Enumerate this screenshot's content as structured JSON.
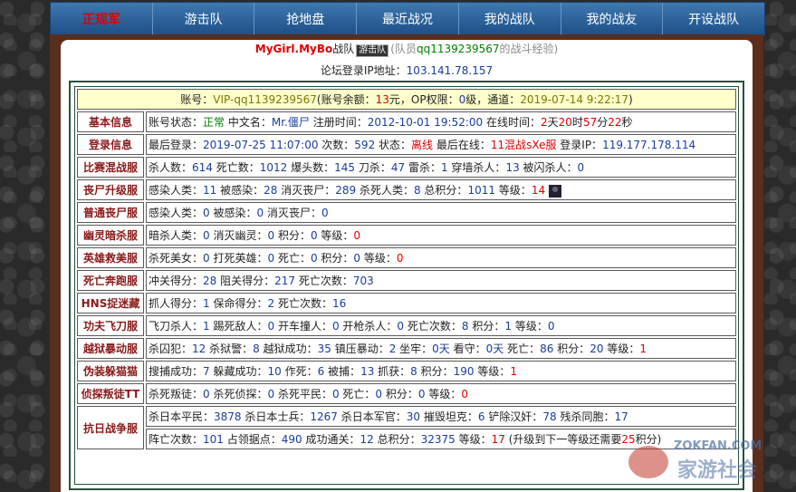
{
  "nav": [
    "正规军",
    "游击队",
    "抢地盘",
    "最近战况",
    "我的战队",
    "我的战友",
    "开设战队"
  ],
  "title": {
    "team": "MyGirl.MyBo",
    "team_suffix": "战队",
    "badge": "游击队",
    "member_prefix": "(队员",
    "member": "qq1139239567",
    "member_suffix": "的战斗经验)"
  },
  "ip": {
    "label": "论坛登录IP地址：",
    "value": "103.141.78.157"
  },
  "account": {
    "l1": "账号：",
    "id": "VIP-qq1139239567",
    "l2": "(账号余额：",
    "balance": "13",
    "l3": "元，OP权限：",
    "op": "0",
    "l4": "级，通道：",
    "date": "2019-07-14 9:22:17",
    "l5": ")"
  },
  "rows": [
    {
      "label": "基本信息",
      "parts": [
        [
          "账号状态：",
          ""
        ],
        [
          "正常",
          "g"
        ],
        [
          " 中文名：",
          ""
        ],
        [
          "Mr.僵尸",
          "b"
        ],
        [
          " 注册时间：",
          ""
        ],
        [
          "2012-10-01 19:52:00",
          "b"
        ],
        [
          " 在线时间：",
          ""
        ],
        [
          "2",
          "r"
        ],
        [
          "天",
          ""
        ],
        [
          "20",
          "r"
        ],
        [
          "时",
          ""
        ],
        [
          "57",
          "r"
        ],
        [
          "分",
          ""
        ],
        [
          "22",
          "r"
        ],
        [
          "秒",
          ""
        ]
      ]
    },
    {
      "label": "登录信息",
      "parts": [
        [
          "最后登录：",
          ""
        ],
        [
          "2019-07-25 11:07:00",
          "b"
        ],
        [
          " 次数：",
          ""
        ],
        [
          "592",
          "b"
        ],
        [
          " 状态：",
          ""
        ],
        [
          "离线",
          "r"
        ],
        [
          " 最后在线：",
          ""
        ],
        [
          "11混战sXe服",
          "r"
        ],
        [
          " 登录IP：",
          ""
        ],
        [
          "119.177.178.114",
          "b"
        ]
      ]
    },
    {
      "label": "比赛混战服",
      "parts": [
        [
          "杀人数：",
          ""
        ],
        [
          "614",
          "b"
        ],
        [
          " 死亡数：",
          ""
        ],
        [
          "1012",
          "b"
        ],
        [
          " 爆头数：",
          ""
        ],
        [
          "145",
          "b"
        ],
        [
          " 刀杀：",
          ""
        ],
        [
          "47",
          "b"
        ],
        [
          " 雷杀：",
          ""
        ],
        [
          "1",
          "b"
        ],
        [
          " 穿墙杀人：",
          ""
        ],
        [
          "13",
          "b"
        ],
        [
          " 被闪杀人：",
          ""
        ],
        [
          "0",
          "b"
        ]
      ]
    },
    {
      "label": "丧尸升级服",
      "avatar": true,
      "parts": [
        [
          "感染人类：",
          ""
        ],
        [
          "11",
          "b"
        ],
        [
          " 被感染：",
          ""
        ],
        [
          "28",
          "b"
        ],
        [
          " 消灭丧尸：",
          ""
        ],
        [
          "289",
          "b"
        ],
        [
          " 杀死人类：",
          ""
        ],
        [
          "8",
          "b"
        ],
        [
          " 总积分：",
          ""
        ],
        [
          "1011",
          "b"
        ],
        [
          " 等级：",
          ""
        ],
        [
          "14",
          "r"
        ]
      ]
    },
    {
      "label": "普通丧尸服",
      "parts": [
        [
          "感染人类：",
          ""
        ],
        [
          "0",
          "b"
        ],
        [
          " 被感染：",
          ""
        ],
        [
          "0",
          "b"
        ],
        [
          " 消灭丧尸：",
          ""
        ],
        [
          "0",
          "b"
        ]
      ]
    },
    {
      "label": "幽灵暗杀服",
      "parts": [
        [
          "暗杀人类：",
          ""
        ],
        [
          "0",
          "b"
        ],
        [
          " 消灭幽灵：",
          ""
        ],
        [
          "0",
          "b"
        ],
        [
          " 积分：",
          ""
        ],
        [
          "0",
          "b"
        ],
        [
          " 等级：",
          ""
        ],
        [
          "0",
          "r"
        ]
      ]
    },
    {
      "label": "英雄救美服",
      "parts": [
        [
          "杀死美女：",
          ""
        ],
        [
          "0",
          "b"
        ],
        [
          " 打死英雄：",
          ""
        ],
        [
          "0",
          "b"
        ],
        [
          " 死亡：",
          ""
        ],
        [
          "0",
          "b"
        ],
        [
          " 积分：",
          ""
        ],
        [
          "0",
          "b"
        ],
        [
          " 等级：",
          ""
        ],
        [
          "0",
          "r"
        ]
      ]
    },
    {
      "label": "死亡奔跑服",
      "parts": [
        [
          "冲关得分：",
          ""
        ],
        [
          "28",
          "b"
        ],
        [
          " 阻关得分：",
          ""
        ],
        [
          "217",
          "b"
        ],
        [
          " 死亡次数：",
          ""
        ],
        [
          "703",
          "b"
        ]
      ]
    },
    {
      "label": "HNS捉迷藏",
      "parts": [
        [
          "抓人得分：",
          ""
        ],
        [
          "1",
          "b"
        ],
        [
          " 保命得分：",
          ""
        ],
        [
          "2",
          "b"
        ],
        [
          " 死亡次数：",
          ""
        ],
        [
          "16",
          "b"
        ]
      ]
    },
    {
      "label": "功夫飞刀服",
      "parts": [
        [
          "飞刀杀人：",
          ""
        ],
        [
          "1",
          "b"
        ],
        [
          " 踢死敌人：",
          ""
        ],
        [
          "0",
          "b"
        ],
        [
          " 开车撞人：",
          ""
        ],
        [
          "0",
          "b"
        ],
        [
          " 开枪杀人：",
          ""
        ],
        [
          "0",
          "b"
        ],
        [
          " 死亡次数：",
          ""
        ],
        [
          "8",
          "b"
        ],
        [
          " 积分：",
          ""
        ],
        [
          "1",
          "b"
        ],
        [
          " 等级：",
          ""
        ],
        [
          "0",
          "b"
        ]
      ]
    },
    {
      "label": "越狱暴动服",
      "parts": [
        [
          "杀囚犯：",
          ""
        ],
        [
          "12",
          "b"
        ],
        [
          " 杀狱警：",
          ""
        ],
        [
          "8",
          "b"
        ],
        [
          " 越狱成功：",
          ""
        ],
        [
          "35",
          "b"
        ],
        [
          " 镇压暴动：",
          ""
        ],
        [
          "2",
          "b"
        ],
        [
          " 坐牢：",
          ""
        ],
        [
          "0天",
          "b"
        ],
        [
          " 看守：",
          ""
        ],
        [
          "0天",
          "b"
        ],
        [
          " 死亡：",
          ""
        ],
        [
          "86",
          "b"
        ],
        [
          " 积分：",
          ""
        ],
        [
          "20",
          "b"
        ],
        [
          " 等级：",
          ""
        ],
        [
          "1",
          "r"
        ]
      ]
    },
    {
      "label": "伪装躲猫猫",
      "parts": [
        [
          "搜捕成功：",
          ""
        ],
        [
          "7",
          "b"
        ],
        [
          " 躲藏成功：",
          ""
        ],
        [
          "10",
          "b"
        ],
        [
          " 作死：",
          ""
        ],
        [
          "6",
          "b"
        ],
        [
          " 被捕：",
          ""
        ],
        [
          "13",
          "b"
        ],
        [
          " 抓获：",
          ""
        ],
        [
          "8",
          "b"
        ],
        [
          " 积分：",
          ""
        ],
        [
          "190",
          "b"
        ],
        [
          " 等级：",
          ""
        ],
        [
          "1",
          "r"
        ]
      ]
    },
    {
      "label": "侦探叛徒TT",
      "parts": [
        [
          "杀死叛徒：",
          ""
        ],
        [
          "0",
          "b"
        ],
        [
          " 杀死侦探：",
          ""
        ],
        [
          "0",
          "b"
        ],
        [
          " 杀死平民：",
          ""
        ],
        [
          "0",
          "b"
        ],
        [
          " 死亡：",
          ""
        ],
        [
          "0",
          "b"
        ],
        [
          " 积分：",
          ""
        ],
        [
          "0",
          "b"
        ],
        [
          " 等级：",
          ""
        ],
        [
          "0",
          "r"
        ]
      ]
    }
  ],
  "war": {
    "label": "抗日战争服",
    "line1": [
      [
        "杀日本平民：",
        ""
      ],
      [
        "3878",
        "b"
      ],
      [
        " 杀日本士兵：",
        ""
      ],
      [
        "1267",
        "b"
      ],
      [
        " 杀日本军官：",
        ""
      ],
      [
        "30",
        "b"
      ],
      [
        " 摧毁坦克：",
        ""
      ],
      [
        "6",
        "b"
      ],
      [
        " 铲除汉奸：",
        ""
      ],
      [
        "78",
        "b"
      ],
      [
        " 残杀同胞：",
        ""
      ],
      [
        "17",
        "b"
      ]
    ],
    "line2": [
      [
        "阵亡次数：",
        ""
      ],
      [
        "101",
        "b"
      ],
      [
        " 占领据点：",
        ""
      ],
      [
        "490",
        "b"
      ],
      [
        " 成功通关：",
        ""
      ],
      [
        "12",
        "b"
      ],
      [
        " 总积分：",
        ""
      ],
      [
        "32375",
        "b"
      ],
      [
        " 等级：",
        ""
      ],
      [
        "17",
        "r"
      ],
      [
        " (升级到下一等级还需要",
        ""
      ],
      [
        "25",
        "r"
      ],
      [
        "积分)",
        ""
      ]
    ]
  },
  "watermark": {
    "site": "ZOKFAN.COM",
    "text": "家游社会"
  }
}
